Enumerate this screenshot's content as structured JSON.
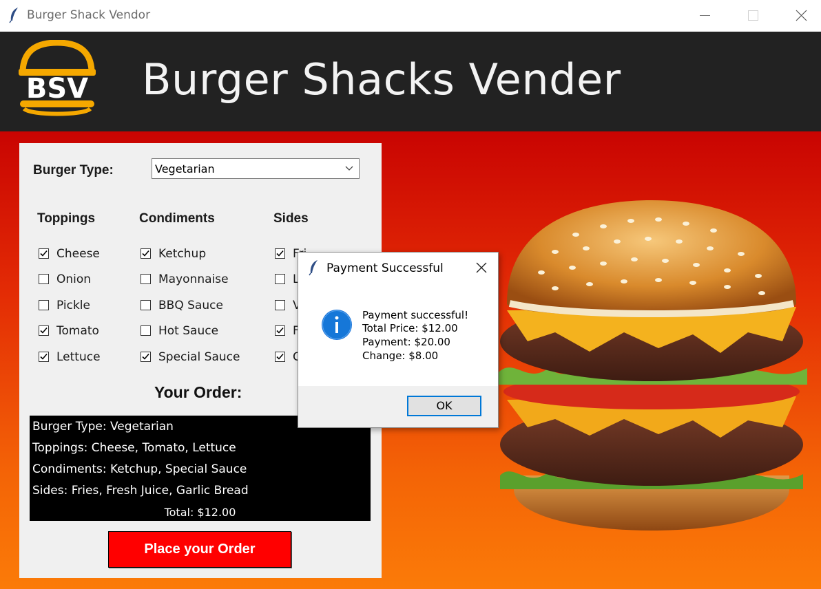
{
  "window": {
    "title": "Burger Shack Vendor",
    "icon": "feather-icon",
    "controls": [
      "minimize",
      "maximize",
      "close"
    ]
  },
  "header": {
    "logo_text": "BSV",
    "title": "Burger Shacks Vender",
    "logo_color": "#f5a800",
    "background": "#222222"
  },
  "form": {
    "burger_type_label": "Burger Type:",
    "burger_type_value": "Vegetarian",
    "columns": [
      {
        "heading": "Toppings",
        "items": [
          {
            "label": "Cheese",
            "checked": true
          },
          {
            "label": "Onion",
            "checked": false
          },
          {
            "label": "Pickle",
            "checked": false
          },
          {
            "label": "Tomato",
            "checked": true
          },
          {
            "label": "Lettuce",
            "checked": true
          }
        ]
      },
      {
        "heading": "Condiments",
        "items": [
          {
            "label": "Ketchup",
            "checked": true
          },
          {
            "label": "Mayonnaise",
            "checked": false
          },
          {
            "label": "BBQ Sauce",
            "checked": false
          },
          {
            "label": "Hot Sauce",
            "checked": false
          },
          {
            "label": "Special Sauce",
            "checked": true
          }
        ]
      },
      {
        "heading": "Sides",
        "items": [
          {
            "label": "Fri",
            "checked": true
          },
          {
            "label": "L",
            "checked": false
          },
          {
            "label": "V",
            "checked": false
          },
          {
            "label": "F",
            "checked": true
          },
          {
            "label": "G",
            "checked": true
          }
        ]
      }
    ],
    "order_title": "Your Order:",
    "order_lines": [
      "Burger Type: Vegetarian",
      "Toppings: Cheese, Tomato, Lettuce",
      "Condiments: Ketchup, Special Sauce",
      "Sides: Fries, Fresh Juice, Garlic Bread"
    ],
    "order_total": "Total: $12.00",
    "place_button": "Place your Order",
    "place_button_color": "#ff0000"
  },
  "dialog": {
    "title": "Payment Successful",
    "icon": "info-icon",
    "message_lines": [
      "Payment successful!",
      "Total Price: $12.00",
      "Payment: $20.00",
      "Change: $8.00"
    ],
    "ok_label": "OK",
    "accent": "#0078d7"
  }
}
